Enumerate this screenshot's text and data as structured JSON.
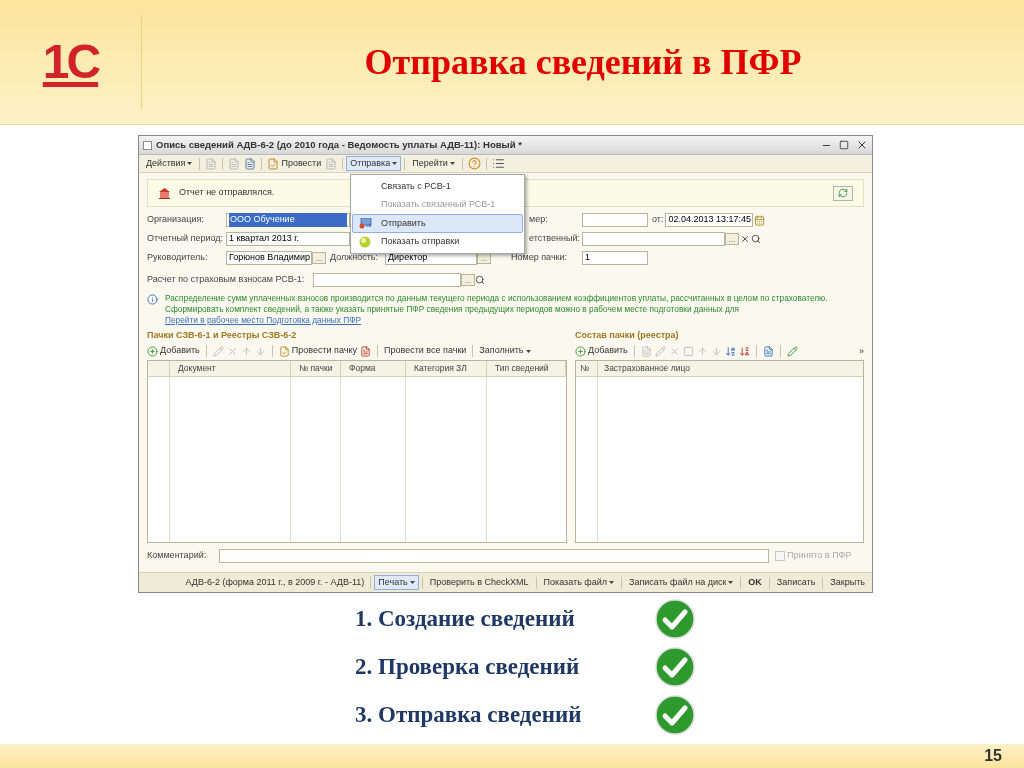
{
  "logo": {
    "text": "1С"
  },
  "title": "Отправка сведений в ПФР",
  "window": {
    "title": "Опись сведений АДВ-6-2 (до 2010 года - Ведомость уплаты АДВ-11): Новый *",
    "toolbar": [
      {
        "kind": "menu",
        "label": "Действия",
        "open": false
      },
      {
        "kind": "sep"
      },
      {
        "kind": "icon",
        "disabled": true
      },
      {
        "kind": "sep"
      },
      {
        "kind": "icon",
        "disabled": true
      },
      {
        "kind": "icon",
        "disabled": false
      },
      {
        "kind": "sep"
      },
      {
        "kind": "button",
        "label": "Провести",
        "disabled": false
      },
      {
        "kind": "icon",
        "disabled": true
      },
      {
        "kind": "sep"
      },
      {
        "kind": "menu",
        "label": "Отправка",
        "open": true
      },
      {
        "kind": "sep"
      },
      {
        "kind": "menu",
        "label": "Перейти",
        "open": false
      },
      {
        "kind": "sep"
      },
      {
        "kind": "help"
      },
      {
        "kind": "sep"
      },
      {
        "kind": "list"
      }
    ],
    "menu": [
      {
        "label": "Связать с РСВ-1",
        "disabled": false,
        "selected": false,
        "kind": "plain"
      },
      {
        "label": "Показать связанный РСВ-1",
        "disabled": true,
        "selected": false,
        "kind": "plain"
      },
      {
        "label": "Отправить",
        "disabled": false,
        "selected": true,
        "kind": "send"
      },
      {
        "label": "Показать отправки",
        "disabled": false,
        "selected": false,
        "kind": "ball"
      }
    ],
    "browse": [
      "...",
      "...",
      "...",
      "..."
    ],
    "notice": "Отчет не отправлялся.",
    "form": {
      "org_label": "Организация:",
      "org_value": "ООО Обучение",
      "org_selected": true,
      "number_label": "мер:",
      "date_label": "от:",
      "date_value": "02.04.2013 13:17:45",
      "period_label": "Отчетный период:",
      "period_value": "1 квартал 2013 г.",
      "resp_label": "етственный:",
      "head_label": "Руководитель:",
      "head_value": "Горюнов Владимир",
      "pos_label": "Должность:",
      "pos_value": "Директор",
      "pack_label": "Номер пачки:",
      "pack_value": "1",
      "rsv_label": "Расчет по страховым взносам РСВ-1:"
    },
    "info": "Распределение сумм уплаченных взносов производится по данным текущего периода с использованием коэффициентов уплаты, рассчитанных в целом по страхователю. Сформировать комплект сведений, а также указать принятые ПФР сведения предыдущих периодов можно в рабочем месте подготовки данных для",
    "info_link": "Перейти в рабочее место Подготовка данных ПФР",
    "left": {
      "title": "Пачки СЗВ-6-1 и Реестры СЗВ-6-2",
      "add": "Добавить",
      "post": "Провести пачку",
      "post_all": "Провести все пачки",
      "fill": "Заполнить",
      "columns": [
        "Документ",
        "№ пачки",
        "Форма",
        "Категория ЗЛ",
        "Тип сведений"
      ]
    },
    "right": {
      "title": "Состав пачки (реестра)",
      "add": "Добавить",
      "more": "»",
      "columns": [
        "№",
        "Застрахованное лицо"
      ]
    },
    "comment_label": "Комментарий:",
    "accepted": {
      "label": "Принято в ПФР",
      "checked": false,
      "disabled": true
    },
    "bottom": [
      {
        "kind": "text",
        "label": "АДВ-6-2 (форма 2011 г., в 2009 г. - АДВ-11)",
        "highlighted": false
      },
      {
        "kind": "menu",
        "label": "Печать",
        "highlighted": true
      },
      {
        "kind": "button",
        "label": "Проверить в CheckXML",
        "highlighted": false
      },
      {
        "kind": "menu",
        "label": "Показать файл",
        "highlighted": false
      },
      {
        "kind": "menu",
        "label": "Записать файл на диск",
        "highlighted": false
      },
      {
        "kind": "default",
        "label": "OK",
        "highlighted": false
      },
      {
        "kind": "button",
        "label": "Записать",
        "highlighted": false
      },
      {
        "kind": "button",
        "label": "Закрыть",
        "highlighted": false
      }
    ]
  },
  "steps": [
    {
      "text": "1. Создание сведений",
      "done": true
    },
    {
      "text": "2. Проверка сведений",
      "done": true
    },
    {
      "text": "3. Отправка сведений",
      "done": true
    }
  ],
  "page": "15"
}
